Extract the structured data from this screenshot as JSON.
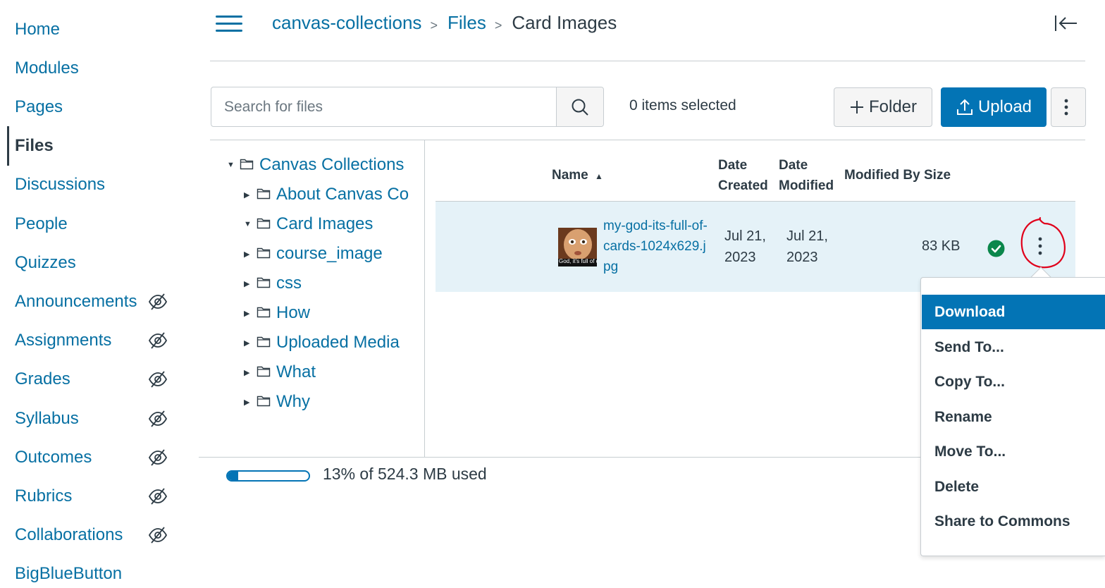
{
  "nav": {
    "items": [
      {
        "label": "Home",
        "hidden": false
      },
      {
        "label": "Modules",
        "hidden": false
      },
      {
        "label": "Pages",
        "hidden": false
      },
      {
        "label": "Files",
        "hidden": false,
        "active": true
      },
      {
        "label": "Discussions",
        "hidden": false
      },
      {
        "label": "People",
        "hidden": false
      },
      {
        "label": "Quizzes",
        "hidden": false
      },
      {
        "label": "Announcements",
        "hidden": true
      },
      {
        "label": "Assignments",
        "hidden": true
      },
      {
        "label": "Grades",
        "hidden": true
      },
      {
        "label": "Syllabus",
        "hidden": true
      },
      {
        "label": "Outcomes",
        "hidden": true
      },
      {
        "label": "Rubrics",
        "hidden": true
      },
      {
        "label": "Collaborations",
        "hidden": true
      },
      {
        "label": "BigBlueButton",
        "hidden": false
      }
    ]
  },
  "breadcrumb": {
    "items": [
      "canvas-collections",
      "Files",
      "Card Images"
    ]
  },
  "toolbar": {
    "search_placeholder": "Search for files",
    "selected_count": "0 items selected",
    "folder_label": "Folder",
    "upload_label": "Upload"
  },
  "tree": {
    "items": [
      {
        "label": "Canvas Collections",
        "expanded": true
      },
      {
        "label": "About Canvas Co",
        "expanded": false
      },
      {
        "label": "Card Images",
        "expanded": true
      },
      {
        "label": "course_image",
        "expanded": false
      },
      {
        "label": "css",
        "expanded": false
      },
      {
        "label": "How",
        "expanded": false
      },
      {
        "label": "Uploaded Media",
        "expanded": false
      },
      {
        "label": "What",
        "expanded": false
      },
      {
        "label": "Why",
        "expanded": false
      }
    ]
  },
  "columns": {
    "name": "Name",
    "created_l1": "Date",
    "created_l2": "Created",
    "modified_l1": "Date",
    "modified_l2": "Modified",
    "modified_by": "Modified By",
    "size": "Size"
  },
  "file": {
    "name": "my-god-its-full-of-cards-1024x629.jpg",
    "thumb_caption": "God, it's full of ca",
    "created_l1": "Jul 21,",
    "created_l2": "2023",
    "modified_l1": "Jul 21,",
    "modified_l2": "2023",
    "modified_by": "",
    "size": "83 KB",
    "published": true
  },
  "quota": {
    "text": "13% of 524.3 MB used",
    "percent_used": 13
  },
  "menu": {
    "items": [
      "Download",
      "Send To...",
      "Copy To...",
      "Rename",
      "Move To...",
      "Delete",
      "Share to Commons"
    ],
    "highlighted": "Download"
  },
  "colors": {
    "link": "#0770a3",
    "primary": "#0374b5",
    "text": "#2d3b45",
    "row_selected": "#e5f2f8",
    "published": "#0b874b",
    "annotation": "#e0001b"
  }
}
